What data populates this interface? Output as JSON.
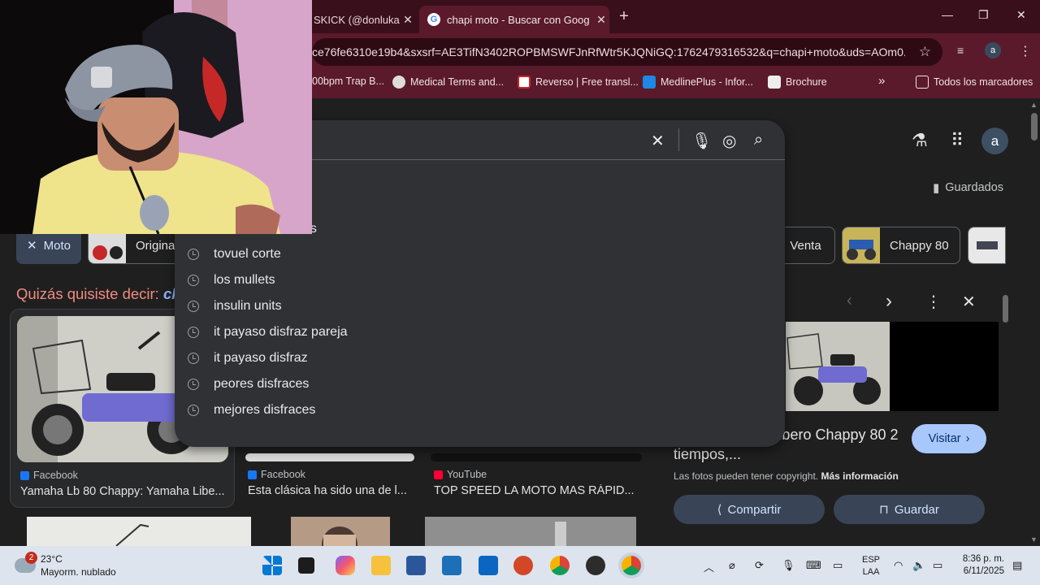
{
  "browser": {
    "tabs": [
      {
        "title": "SKICK (@donluka",
        "active": false
      },
      {
        "title": "chapi moto - Buscar con Goog",
        "active": true
      }
    ],
    "new_tab_symbol": "+",
    "url": "ce76fe6310e19b4&sxsrf=AE3TifN3402ROPBMSWFJnRfWtr5KJQNiGQ:1762479316532&q=chapi+moto&uds=AOm0...",
    "profile_initial": "a",
    "bookmarks": [
      {
        "label": "00bpm Trap B..."
      },
      {
        "label": "Medical Terms and..."
      },
      {
        "label": "Reverso | Free transl..."
      },
      {
        "label": "MedlinePlus - Infor..."
      },
      {
        "label": "Brochure"
      }
    ],
    "all_bookmarks": "Todos los marcadores"
  },
  "google": {
    "avatar_initial": "a",
    "saved_label": "Guardados",
    "chips": [
      {
        "label": "Moto",
        "selected": true
      },
      {
        "label": "Origina"
      },
      {
        "label": "Venta"
      },
      {
        "label": "Chappy 80"
      }
    ],
    "did_you_mean_prefix": "Quizás quisiste decir: ",
    "did_you_mean_term": "ch",
    "suggestions": [
      "tovuel corte",
      "los mullets",
      "insulin units",
      "it payaso disfraz pareja",
      "it payaso disfraz",
      "peores disfraces",
      "mejores disfraces"
    ],
    "partial_suggestion": "sos",
    "results": [
      {
        "source": "Facebook",
        "caption": "Yamaha Lb 80 Chappy: Yamaha Libe..."
      },
      {
        "source": "Facebook",
        "caption": "Esta clásica ha sido una de l..."
      },
      {
        "source": "YouTube",
        "caption": "TOP SPEED LA MOTO MAS RÁPID..."
      }
    ],
    "panel": {
      "title": "appy: Yamaha Libero Chappy 80 2 tiempos,...",
      "visit_label": "Visitar",
      "copyright_text": "Las fotos pueden tener copyright. ",
      "more_info": "Más información",
      "share_label": "Compartir",
      "save_label": "Guardar"
    }
  },
  "taskbar": {
    "notif_count": "2",
    "temperature": "23°C",
    "weather": "Mayorm. nublado",
    "lang_line1": "ESP",
    "lang_line2": "LAA",
    "time": "8:36 p. m.",
    "date": "6/11/2025"
  },
  "colors": {
    "accent_chrome": "#5a1a2b",
    "google_bg": "#1f1f1f",
    "link_blue": "#8ab4f8",
    "did_you_mean_red": "#f28b82"
  }
}
